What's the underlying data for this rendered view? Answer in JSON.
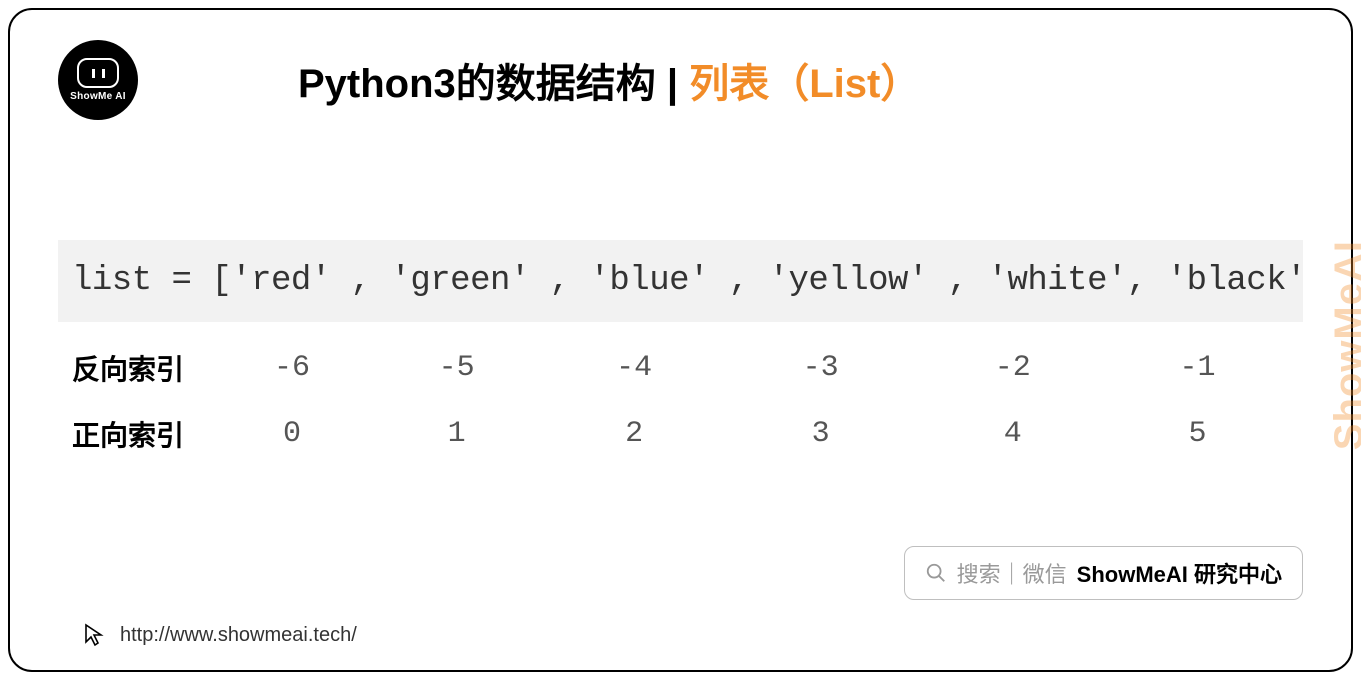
{
  "logo": {
    "text": "ShowMe AI"
  },
  "title": {
    "main": "Python3的数据结构",
    "sep": " | ",
    "accent": "列表（List）"
  },
  "code": "list = ['red' , 'green' , 'blue' , 'yellow' , 'white', 'black']",
  "rows": {
    "negative": {
      "label": "反向索引",
      "values": [
        "-6",
        "-5",
        "-4",
        "-3",
        "-2",
        "-1"
      ]
    },
    "positive": {
      "label": "正向索引",
      "values": [
        "0",
        "1",
        "2",
        "3",
        "4",
        "5"
      ]
    }
  },
  "watermark": "ShowMeAI",
  "search": {
    "prefix": "搜索｜微信",
    "bold": "ShowMeAI 研究中心"
  },
  "footer": {
    "url": "http://www.showmeai.tech/"
  }
}
